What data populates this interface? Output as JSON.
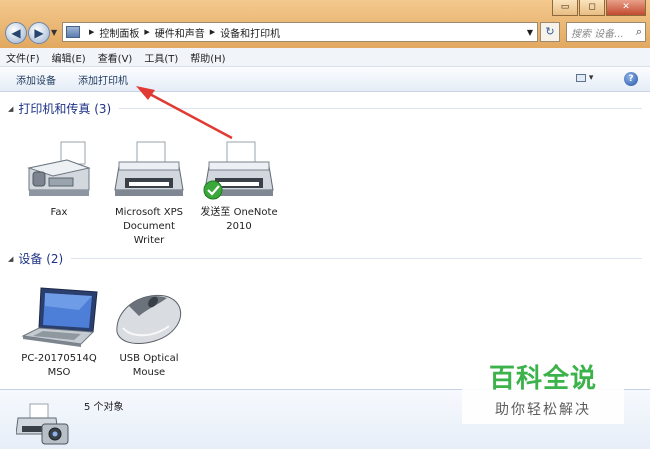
{
  "titlebar": {
    "window_buttons": [
      "minimize",
      "maximize",
      "close"
    ],
    "window_button_glyphs": [
      "▭",
      "◻",
      "✕"
    ],
    "back_glyph": "◀",
    "forward_glyph": "▶",
    "breadcrumbs": [
      "控制面板",
      "硬件和声音",
      "设备和打印机"
    ],
    "refresh_glyph": "↻",
    "search_placeholder": "搜索 设备...",
    "search_glyph": "🔍"
  },
  "menubar": {
    "items": [
      "文件(F)",
      "编辑(E)",
      "查看(V)",
      "工具(T)",
      "帮助(H)"
    ]
  },
  "commandbar": {
    "items": [
      "添加设备",
      "添加打印机"
    ],
    "help_glyph": "?"
  },
  "groups": [
    {
      "title": "打印机和传真 (3)",
      "devices": [
        {
          "label_lines": [
            "Fax"
          ],
          "icon": "fax-icon"
        },
        {
          "label_lines": [
            "Microsoft XPS",
            "Document",
            "Writer"
          ],
          "icon": "printer-icon"
        },
        {
          "label_lines": [
            "发送至 OneNote",
            "2010"
          ],
          "icon": "printer-default-icon"
        }
      ]
    },
    {
      "title": "设备 (2)",
      "devices": [
        {
          "label_lines": [
            "PC-20170514Q",
            "MSO"
          ],
          "icon": "laptop-icon"
        },
        {
          "label_lines": [
            "USB Optical",
            "Mouse"
          ],
          "icon": "mouse-icon"
        }
      ]
    }
  ],
  "details": {
    "count_text": "5 个对象"
  },
  "watermark": {
    "main": "百科全说",
    "sub": "助你轻松解决"
  },
  "colors": {
    "titlebar": "#eab775",
    "group_title": "#1e3287",
    "annotation_arrow": "#e03a35",
    "watermark_green": "#2fae3f"
  }
}
